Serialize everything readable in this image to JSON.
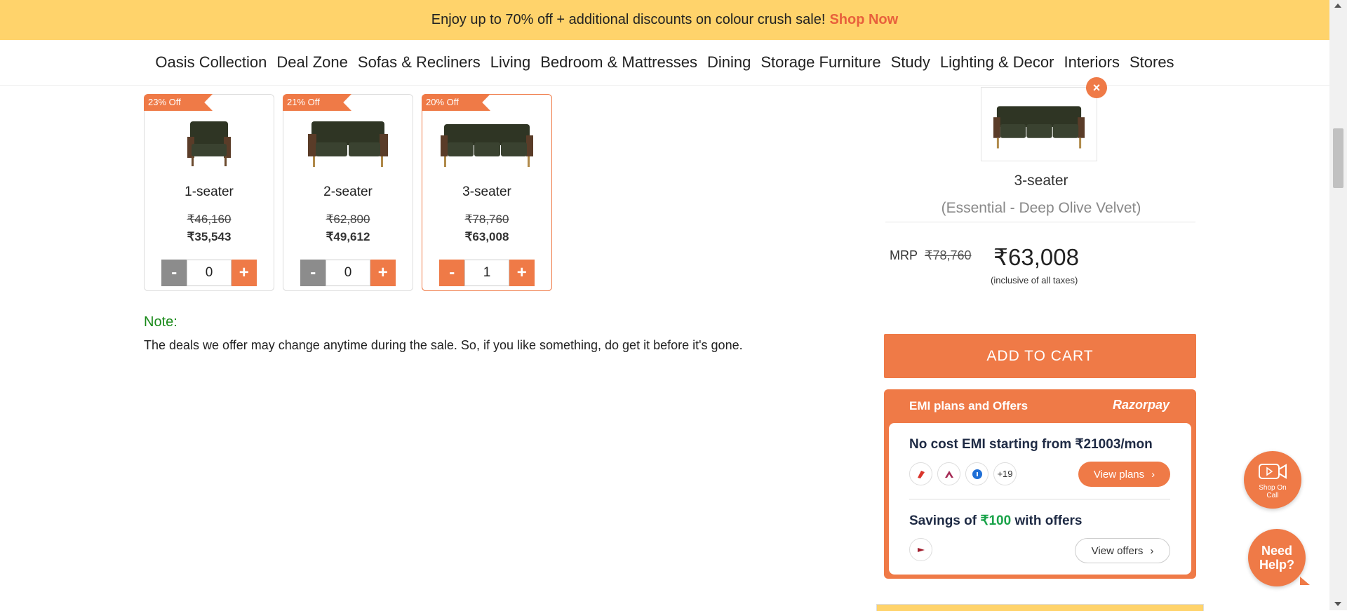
{
  "banner": {
    "text": "Enjoy up to 70% off + additional discounts on colour crush sale!",
    "link": "Shop Now"
  },
  "nav": [
    "Oasis Collection",
    "Deal Zone",
    "Sofas & Recliners",
    "Living",
    "Bedroom & Mattresses",
    "Dining",
    "Storage Furniture",
    "Study",
    "Lighting & Decor",
    "Interiors",
    "Stores"
  ],
  "products": [
    {
      "badge": "23% Off",
      "name": "1-seater",
      "old_price": "₹46,160",
      "price": "₹35,543",
      "qty": "0",
      "minus": "-",
      "plus": "+"
    },
    {
      "badge": "21% Off",
      "name": "2-seater",
      "old_price": "₹62,800",
      "price": "₹49,612",
      "qty": "0",
      "minus": "-",
      "plus": "+"
    },
    {
      "badge": "20% Off",
      "name": "3-seater",
      "old_price": "₹78,760",
      "price": "₹63,008",
      "qty": "1",
      "minus": "-",
      "plus": "+"
    }
  ],
  "note": {
    "title": "Note:",
    "text": "The deals we offer may change anytime during the sale. So, if you like something, do get it before it's gone."
  },
  "summary": {
    "close": "×",
    "name": "3-seater",
    "variant": "(Essential - Deep Olive Velvet)",
    "mrp_label": "MRP",
    "mrp": "₹78,760",
    "price": "₹63,008",
    "tax_note": "(inclusive of all taxes)",
    "add_to_cart": "ADD TO CART"
  },
  "emi": {
    "header": "EMI plans and Offers",
    "brand": "Razorpay",
    "no_cost": "No cost EMI starting from ₹21003/mon",
    "more_banks": "+19",
    "view_plans": "View plans",
    "savings_prefix": "Savings of",
    "savings_amount": "₹100",
    "savings_suffix": "with offers",
    "view_offers": "View offers"
  },
  "floating": {
    "shop_on_call": "Shop On Call",
    "need_help": "Need Help?"
  },
  "colors": {
    "accent": "#ef7a47",
    "banner": "#ffd36b",
    "note_green": "#1a8a1a"
  }
}
